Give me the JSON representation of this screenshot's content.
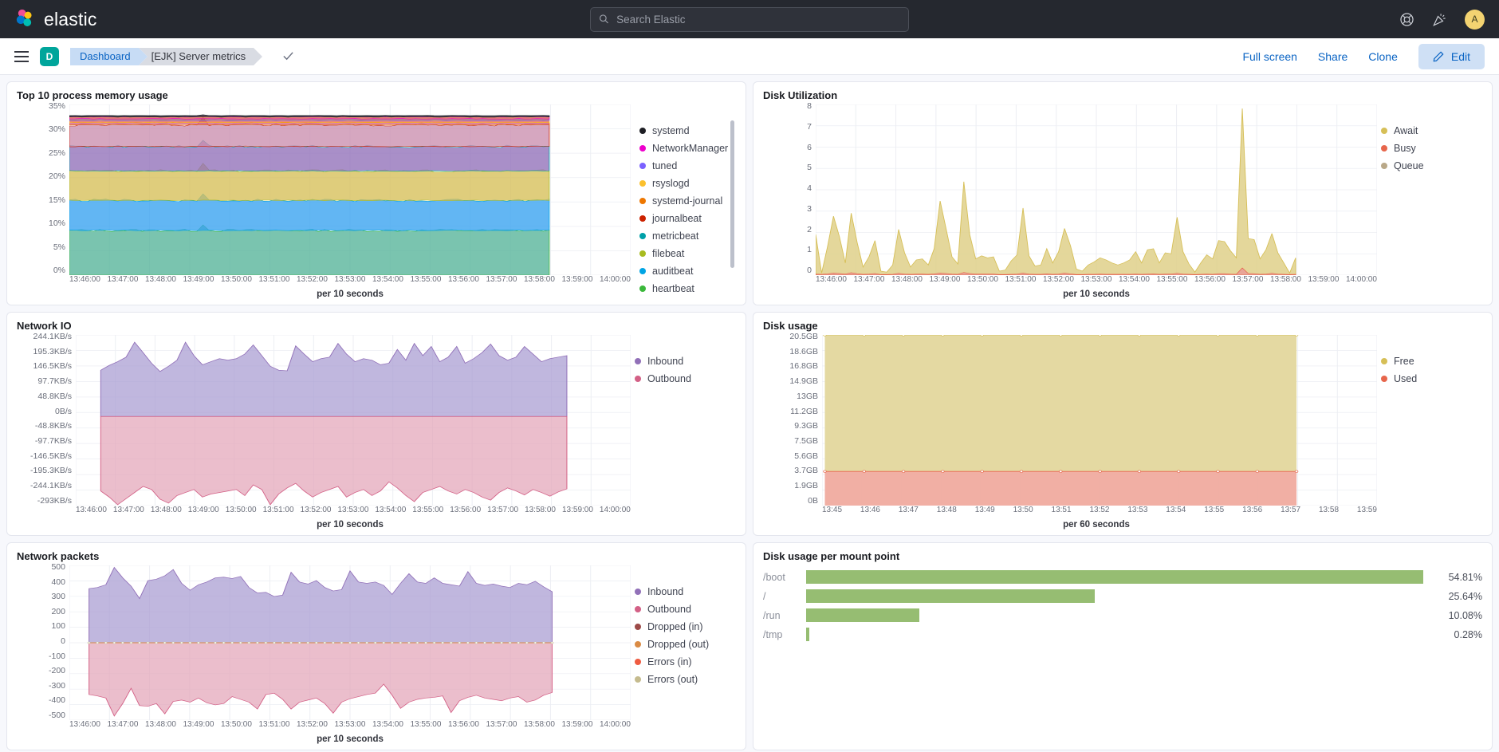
{
  "header": {
    "brand": "elastic",
    "search_placeholder": "Search Elastic",
    "search_value": "",
    "avatar_initial": "A",
    "help_icon": "help-icon",
    "announcement_icon": "announcement-icon"
  },
  "breadcrumb": {
    "space_initial": "D",
    "crumb1": "Dashboard",
    "crumb2": "[EJK] Server metrics",
    "actions": {
      "full_screen": "Full screen",
      "share": "Share",
      "clone": "Clone",
      "edit": "Edit"
    }
  },
  "panels": {
    "memory": {
      "title": "Top 10 process memory usage"
    },
    "disk_util": {
      "title": "Disk Utilization"
    },
    "net_io": {
      "title": "Network IO"
    },
    "disk_usage": {
      "title": "Disk usage"
    },
    "net_packets": {
      "title": "Network packets"
    },
    "mount": {
      "title": "Disk usage per mount point"
    }
  },
  "chart_data": [
    {
      "id": "memory",
      "type": "area",
      "title": "Top 10 process memory usage",
      "xlabel": "per 10 seconds",
      "ylabel": "",
      "ytick_labels": [
        "35%",
        "30%",
        "25%",
        "20%",
        "15%",
        "10%",
        "5%",
        "0%"
      ],
      "ylim": [
        0,
        37
      ],
      "xtick_labels": [
        "13:46:00",
        "13:47:00",
        "13:48:00",
        "13:49:00",
        "13:50:00",
        "13:51:00",
        "13:52:00",
        "13:53:00",
        "13:54:00",
        "13:55:00",
        "13:56:00",
        "13:57:00",
        "13:58:00",
        "13:59:00",
        "14:00:00"
      ],
      "stacked": true,
      "grid": true,
      "legend_position": "right",
      "series": [
        {
          "name": "heartbeat",
          "color": "#54b399",
          "band": [
            0,
            9.7
          ]
        },
        {
          "name": "auditbeat",
          "color": "#36a2ef",
          "band": [
            9.7,
            16.2
          ]
        },
        {
          "name": "filebeat",
          "color": "#d6bf57",
          "band": [
            16.2,
            22.6
          ]
        },
        {
          "name": "metricbeat",
          "color": "#9170b8",
          "band": [
            22.6,
            27.9
          ]
        },
        {
          "name": "journalbeat",
          "color": "#ca8eae",
          "band": [
            27.9,
            32.6
          ]
        },
        {
          "name": "systemd-journal",
          "color": "#d36086",
          "band": [
            32.6,
            33.1
          ]
        },
        {
          "name": "rsyslogd",
          "color": "#e7664c",
          "band": [
            33.1,
            33.5
          ]
        },
        {
          "name": "tuned",
          "color": "#aa6556",
          "band": [
            33.5,
            33.9
          ]
        },
        {
          "name": "NetworkManager",
          "color": "#e7664c",
          "band": [
            33.9,
            34.3
          ]
        },
        {
          "name": "systemd",
          "color": "#1d1e24",
          "band": [
            34.3,
            34.6
          ]
        }
      ],
      "legend": [
        {
          "label": "systemd",
          "color": "#1d1e24"
        },
        {
          "label": "NetworkManager",
          "color": "#ee00cc"
        },
        {
          "label": "tuned",
          "color": "#7b61ff"
        },
        {
          "label": "rsyslogd",
          "color": "#fbc02d"
        },
        {
          "label": "systemd-journal",
          "color": "#ee7700"
        },
        {
          "label": "journalbeat",
          "color": "#cc2200"
        },
        {
          "label": "metricbeat",
          "color": "#00a0a8"
        },
        {
          "label": "filebeat",
          "color": "#a8bb20"
        },
        {
          "label": "auditbeat",
          "color": "#00a4e4"
        },
        {
          "label": "heartbeat",
          "color": "#3ab83a"
        }
      ]
    },
    {
      "id": "disk_util",
      "type": "area",
      "title": "Disk Utilization",
      "xlabel": "per 10 seconds",
      "ytick_labels": [
        "8",
        "7",
        "6",
        "5",
        "4",
        "3",
        "2",
        "1",
        "0"
      ],
      "ylim": [
        0,
        8.4
      ],
      "xtick_labels": [
        "13:46:00",
        "13:47:00",
        "13:48:00",
        "13:49:00",
        "13:50:00",
        "13:51:00",
        "13:52:00",
        "13:53:00",
        "13:54:00",
        "13:55:00",
        "13:56:00",
        "13:57:00",
        "13:58:00",
        "13:59:00",
        "14:00:00"
      ],
      "grid": true,
      "legend_position": "right",
      "legend": [
        {
          "label": "Await",
          "color": "#d6bf57"
        },
        {
          "label": "Busy",
          "color": "#e7664c"
        },
        {
          "label": "Queue",
          "color": "#b9a888"
        }
      ],
      "await_values": [
        2.0,
        0.1,
        1.4,
        2.9,
        1.9,
        0.6,
        3.05,
        1.6,
        0.4,
        0.9,
        1.7,
        0.2,
        0.15,
        0.5,
        2.25,
        1.1,
        0.4,
        0.75,
        0.8,
        0.5,
        1.3,
        3.65,
        2.3,
        0.9,
        0.55,
        4.6,
        2.0,
        0.8,
        0.95,
        0.85,
        0.9,
        0.2,
        0.25,
        0.7,
        1.0,
        3.3,
        0.95,
        0.45,
        0.5,
        1.3,
        0.6,
        1.15,
        2.3,
        1.45,
        0.3,
        0.2,
        0.5,
        0.65,
        0.85,
        0.75,
        0.6,
        0.5,
        0.6,
        0.75,
        1.15,
        0.6,
        1.25,
        1.3,
        0.6,
        1.1,
        1.05,
        2.85,
        1.15,
        0.55,
        0.15,
        0.6,
        1.0,
        0.8,
        1.7,
        1.65,
        1.2,
        0.85,
        8.2,
        1.8,
        1.75,
        0.8,
        1.25,
        2.05,
        1.1,
        0.6,
        0.1,
        0.85
      ],
      "busy_values": [
        0.05,
        0.04,
        0.06,
        0.1,
        0.08,
        0.05,
        0.12,
        0.07,
        0.04,
        0.05,
        0.08,
        0.03,
        0.03,
        0.04,
        0.09,
        0.05,
        0.04,
        0.05,
        0.05,
        0.04,
        0.06,
        0.1,
        0.08,
        0.05,
        0.04,
        0.13,
        0.08,
        0.05,
        0.05,
        0.05,
        0.05,
        0.03,
        0.03,
        0.04,
        0.05,
        0.1,
        0.05,
        0.04,
        0.04,
        0.06,
        0.04,
        0.05,
        0.1,
        0.06,
        0.03,
        0.03,
        0.04,
        0.04,
        0.05,
        0.04,
        0.04,
        0.04,
        0.04,
        0.04,
        0.05,
        0.04,
        0.05,
        0.06,
        0.04,
        0.05,
        0.05,
        0.09,
        0.05,
        0.04,
        0.03,
        0.04,
        0.05,
        0.04,
        0.07,
        0.07,
        0.05,
        0.04,
        0.35,
        0.08,
        0.07,
        0.04,
        0.05,
        0.09,
        0.05,
        0.04,
        0.03,
        0.04
      ]
    },
    {
      "id": "net_io",
      "type": "area",
      "title": "Network IO",
      "xlabel": "per 10 seconds",
      "ytick_labels": [
        "244.1KB/s",
        "195.3KB/s",
        "146.5KB/s",
        "97.7KB/s",
        "48.8KB/s",
        "0B/s",
        "-48.8KB/s",
        "-97.7KB/s",
        "-146.5KB/s",
        "-195.3KB/s",
        "-244.1KB/s",
        "-293KB/s"
      ],
      "ylim": [
        -293,
        268
      ],
      "xtick_labels": [
        "13:46:00",
        "13:47:00",
        "13:48:00",
        "13:49:00",
        "13:50:00",
        "13:51:00",
        "13:52:00",
        "13:53:00",
        "13:54:00",
        "13:55:00",
        "13:56:00",
        "13:57:00",
        "13:58:00",
        "13:59:00",
        "14:00:00"
      ],
      "grid": true,
      "legend_position": "right",
      "legend": [
        {
          "label": "Inbound",
          "color": "#9170b8"
        },
        {
          "label": "Outbound",
          "color": "#d36086"
        }
      ],
      "inbound_values": [
        152,
        168,
        180,
        195,
        244,
        210,
        175,
        148,
        165,
        185,
        244,
        200,
        170,
        180,
        190,
        185,
        190,
        205,
        235,
        200,
        165,
        152,
        150,
        232,
        205,
        180,
        190,
        195,
        240,
        205,
        180,
        190,
        185,
        170,
        175,
        220,
        185,
        240,
        200,
        230,
        180,
        195,
        230,
        175,
        190,
        210,
        238,
        200,
        185,
        195,
        230,
        205,
        180,
        190,
        195,
        200
      ],
      "outbound_values": [
        -245,
        -265,
        -290,
        -270,
        -250,
        -230,
        -240,
        -272,
        -285,
        -260,
        -250,
        -240,
        -265,
        -255,
        -250,
        -245,
        -240,
        -260,
        -225,
        -240,
        -290,
        -255,
        -235,
        -220,
        -245,
        -265,
        -250,
        -240,
        -230,
        -265,
        -250,
        -240,
        -260,
        -245,
        -215,
        -235,
        -260,
        -280,
        -250,
        -240,
        -230,
        -245,
        -255,
        -240,
        -250,
        -265,
        -275,
        -250,
        -235,
        -245,
        -258,
        -240,
        -250,
        -262,
        -248,
        -238
      ]
    },
    {
      "id": "disk_usage",
      "type": "area",
      "title": "Disk usage",
      "xlabel": "per 60 seconds",
      "ytick_labels": [
        "20.5GB",
        "18.6GB",
        "16.8GB",
        "14.9GB",
        "13GB",
        "11.2GB",
        "9.3GB",
        "7.5GB",
        "5.6GB",
        "3.7GB",
        "1.9GB",
        "0B"
      ],
      "ylim": [
        0,
        20.5
      ],
      "xtick_labels": [
        "13:45",
        "13:46",
        "13:47",
        "13:48",
        "13:49",
        "13:50",
        "13:51",
        "13:52",
        "13:53",
        "13:54",
        "13:55",
        "13:56",
        "13:57",
        "13:58",
        "13:59"
      ],
      "grid": true,
      "legend_position": "right",
      "legend": [
        {
          "label": "Free",
          "color": "#d6bf57"
        },
        {
          "label": "Used",
          "color": "#e7664c"
        }
      ],
      "used_value_gb": 4.1,
      "total_value_gb": 20.5
    },
    {
      "id": "net_packets",
      "type": "area",
      "title": "Network packets",
      "xlabel": "per 10 seconds",
      "ytick_labels": [
        "500",
        "400",
        "300",
        "200",
        "100",
        "0",
        "-100",
        "-200",
        "-300",
        "-400",
        "-500"
      ],
      "ylim": [
        -560,
        560
      ],
      "xtick_labels": [
        "13:46:00",
        "13:47:00",
        "13:48:00",
        "13:49:00",
        "13:50:00",
        "13:51:00",
        "13:52:00",
        "13:53:00",
        "13:54:00",
        "13:55:00",
        "13:56:00",
        "13:57:00",
        "13:58:00",
        "13:59:00",
        "14:00:00"
      ],
      "grid": true,
      "legend_position": "right",
      "legend": [
        {
          "label": "Inbound",
          "color": "#9170b8"
        },
        {
          "label": "Outbound",
          "color": "#d36086"
        },
        {
          "label": "Dropped (in)",
          "color": "#9c4a48"
        },
        {
          "label": "Dropped (out)",
          "color": "#da8b45"
        },
        {
          "label": "Errors (in)",
          "color": "#ef5b41"
        },
        {
          "label": "Errors (out)",
          "color": "#c5bb8e"
        }
      ],
      "inbound_values": [
        392,
        400,
        420,
        545,
        470,
        410,
        320,
        450,
        460,
        485,
        530,
        430,
        380,
        420,
        440,
        470,
        475,
        465,
        480,
        400,
        360,
        365,
        335,
        345,
        510,
        440,
        425,
        450,
        400,
        375,
        385,
        520,
        440,
        430,
        440,
        415,
        350,
        430,
        500,
        440,
        430,
        470,
        430,
        420,
        410,
        515,
        430,
        415,
        425,
        410,
        400,
        430,
        420,
        445,
        405,
        370
      ],
      "outbound_values": [
        -375,
        -385,
        -400,
        -530,
        -440,
        -330,
        -455,
        -460,
        -440,
        -515,
        -425,
        -415,
        -430,
        -400,
        -435,
        -450,
        -440,
        -390,
        -410,
        -430,
        -480,
        -375,
        -365,
        -410,
        -480,
        -430,
        -415,
        -400,
        -440,
        -510,
        -430,
        -405,
        -390,
        -375,
        -365,
        -300,
        -380,
        -475,
        -430,
        -410,
        -400,
        -395,
        -385,
        -505,
        -420,
        -395,
        -380,
        -400,
        -410,
        -420,
        -400,
        -390,
        -430,
        -415,
        -380,
        -360
      ],
      "zero_series": [
        "Dropped (in)",
        "Dropped (out)",
        "Errors (in)",
        "Errors (out)"
      ]
    },
    {
      "id": "mount",
      "type": "bar",
      "title": "Disk usage per mount point",
      "orientation": "horizontal",
      "bar_color": "#96bd72",
      "categories": [
        "/boot",
        "/",
        "/run",
        "/tmp"
      ],
      "values": [
        54.81,
        25.64,
        10.08,
        0.28
      ],
      "value_labels": [
        "54.81%",
        "25.64%",
        "10.08%",
        "0.28%"
      ],
      "max": 54.81
    }
  ]
}
